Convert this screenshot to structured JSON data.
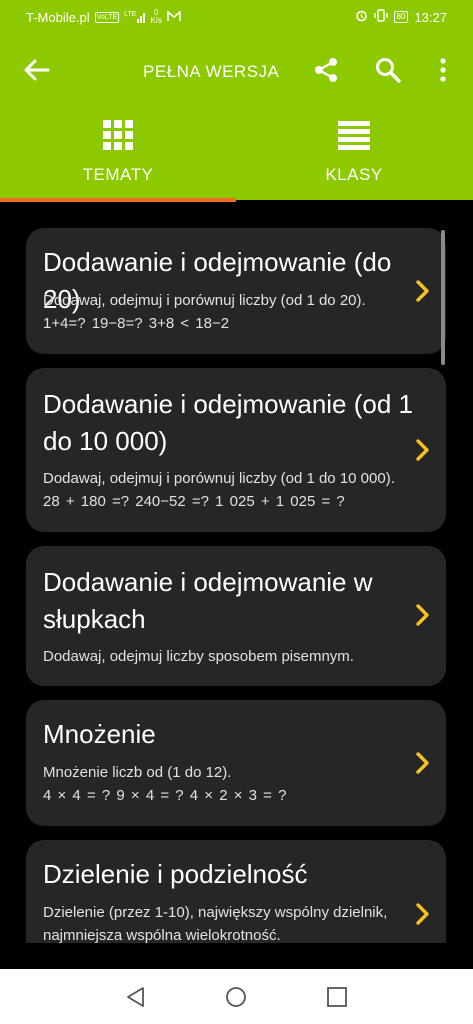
{
  "status": {
    "carrier": "T-Mobile.pl",
    "volte": "VoLTE",
    "network": "LTE",
    "speed_value": "0",
    "speed_unit": "K/s",
    "battery": "80",
    "time": "13:27"
  },
  "toolbar": {
    "title": "PEŁNA WERSJA"
  },
  "tabs": [
    {
      "label": "TEMATY",
      "icon": "grid-icon",
      "active": true
    },
    {
      "label": "KLASY",
      "icon": "list-icon",
      "active": false
    }
  ],
  "topics": [
    {
      "title": "Dodawanie i odejmowanie (do 20)",
      "desc1": "Dodawaj, odejmuj i porównuj liczby (od 1 do 20).",
      "desc2": "1+4=?    19−8=?    3+8 < 18−2"
    },
    {
      "title_line1": "Dodawanie i odejmowanie (od 1",
      "title_line2": "do 10 000)",
      "desc1": "Dodawaj, odejmuj i porównuj liczby (od 1 do 10 000).",
      "desc2": "28 + 180 =?     240−52 =?    1 025 + 1 025 = ?"
    },
    {
      "title_line1": "Dodawanie i odejmowanie w",
      "title_line2": "słupkach",
      "desc1": "Dodawaj, odejmuj liczby sposobem pisemnym."
    },
    {
      "title": "Mnożenie",
      "desc1": "Mnożenie liczb od (1 do 12).",
      "desc2": "4 × 4 = ?    9 × 4 = ?    4 × 2 × 3 = ?"
    },
    {
      "title": "Dzielenie i podzielność",
      "desc1": "Dzielenie (przez 1-10), największy wspólny dzielnik,",
      "desc2": "najmniejsza wspólna wielokrotność."
    }
  ],
  "colors": {
    "accent": "#8dc900",
    "tab_underline": "#f26a22",
    "chevron": "#f6c21b",
    "card": "#262626"
  }
}
